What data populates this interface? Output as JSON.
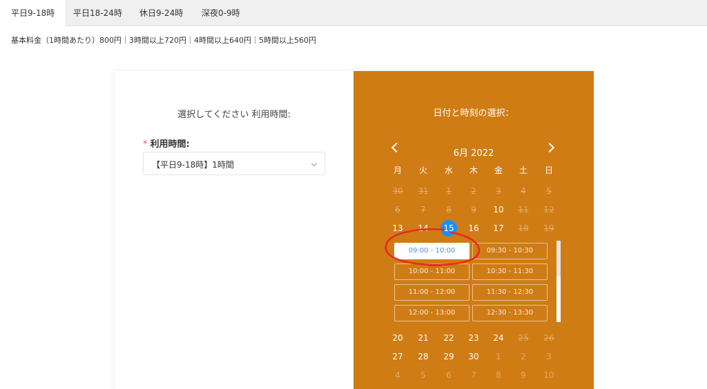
{
  "tabs": [
    {
      "label": "平日9-18時",
      "active": true
    },
    {
      "label": "平日18-24時",
      "active": false
    },
    {
      "label": "休日9-24時",
      "active": false
    },
    {
      "label": "深夜0-9時",
      "active": false
    }
  ],
  "pricing_text": "基本料金（1時間あたり）800円｜3時間以上720円｜4時間以上640円｜5時間以上560円",
  "left": {
    "title": "選択してください 利用時間:",
    "field_required_mark": "*",
    "field_label": "利用時間:",
    "select_value": "【平日9-18時】1時間"
  },
  "calendar": {
    "title": "日付と時刻の選択：",
    "month_label": "6月 2022",
    "weekdays": [
      "月",
      "火",
      "水",
      "木",
      "金",
      "土",
      "日"
    ],
    "weeks": [
      [
        {
          "d": "30",
          "s": "strike"
        },
        {
          "d": "31",
          "s": "strike"
        },
        {
          "d": "1",
          "s": "strike"
        },
        {
          "d": "2",
          "s": "strike"
        },
        {
          "d": "3",
          "s": "strike"
        },
        {
          "d": "4",
          "s": "strike"
        },
        {
          "d": "5",
          "s": "strike"
        }
      ],
      [
        {
          "d": "6",
          "s": "strike"
        },
        {
          "d": "7",
          "s": "strike"
        },
        {
          "d": "8",
          "s": "strike"
        },
        {
          "d": "9",
          "s": "strike"
        },
        {
          "d": "10",
          "s": "normal"
        },
        {
          "d": "11",
          "s": "strike"
        },
        {
          "d": "12",
          "s": "strike"
        }
      ],
      [
        {
          "d": "13",
          "s": "normal"
        },
        {
          "d": "14",
          "s": "normal"
        },
        {
          "d": "15",
          "s": "selected"
        },
        {
          "d": "16",
          "s": "normal"
        },
        {
          "d": "17",
          "s": "normal"
        },
        {
          "d": "18",
          "s": "strike"
        },
        {
          "d": "19",
          "s": "strike"
        }
      ],
      [
        {
          "d": "20",
          "s": "normal"
        },
        {
          "d": "21",
          "s": "normal"
        },
        {
          "d": "22",
          "s": "normal"
        },
        {
          "d": "23",
          "s": "normal"
        },
        {
          "d": "24",
          "s": "normal"
        },
        {
          "d": "25",
          "s": "strike"
        },
        {
          "d": "26",
          "s": "strike"
        }
      ],
      [
        {
          "d": "27",
          "s": "normal"
        },
        {
          "d": "28",
          "s": "normal"
        },
        {
          "d": "29",
          "s": "normal"
        },
        {
          "d": "30",
          "s": "normal"
        },
        {
          "d": "1",
          "s": "muted"
        },
        {
          "d": "2",
          "s": "muted"
        },
        {
          "d": "3",
          "s": "muted"
        }
      ],
      [
        {
          "d": "4",
          "s": "muted"
        },
        {
          "d": "5",
          "s": "muted"
        },
        {
          "d": "6",
          "s": "muted"
        },
        {
          "d": "7",
          "s": "muted"
        },
        {
          "d": "8",
          "s": "muted"
        },
        {
          "d": "9",
          "s": "muted"
        },
        {
          "d": "10",
          "s": "muted"
        }
      ]
    ],
    "time_slots": [
      {
        "label": "09:00 - 10:00",
        "active": true
      },
      {
        "label": "09:30 - 10:30",
        "active": false
      },
      {
        "label": "10:00 - 11:00",
        "active": false
      },
      {
        "label": "10:30 - 11:30",
        "active": false
      },
      {
        "label": "11:00 - 12:00",
        "active": false
      },
      {
        "label": "11:30 - 12:30",
        "active": false
      },
      {
        "label": "12:00 - 13:00",
        "active": false
      },
      {
        "label": "12:30 - 13:30",
        "active": false
      }
    ]
  },
  "colors": {
    "calendar_bg": "#d07c14",
    "selected_day": "#1890ff",
    "annotation": "#e8281e",
    "required_mark": "#e0554e"
  }
}
